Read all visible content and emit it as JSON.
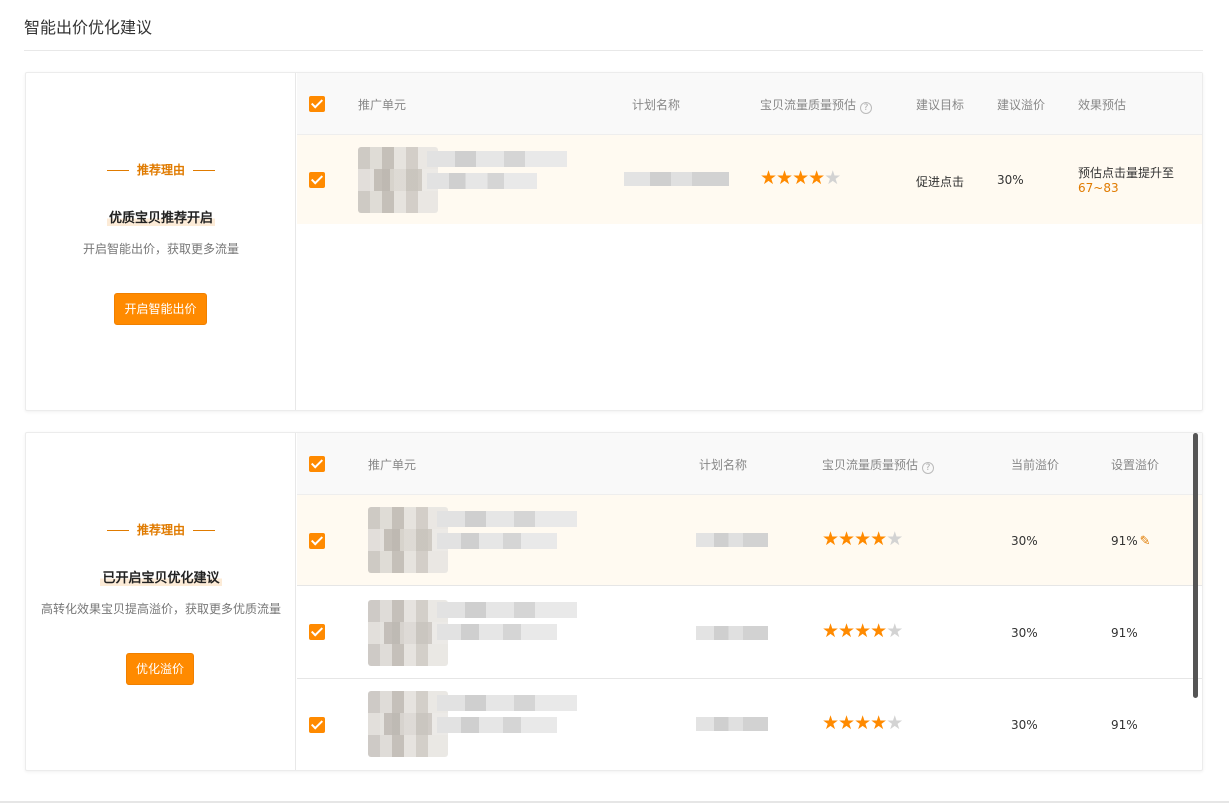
{
  "page_title": "智能出价优化建议",
  "colors": {
    "accent": "#ff8a00",
    "accent_text": "#e07b00",
    "highlight_row": "#fffaf1"
  },
  "section1": {
    "reason_tag": "推荐理由",
    "reason_title": "优质宝贝推荐开启",
    "reason_desc": "开启智能出价，获取更多流量",
    "action_button": "开启智能出价",
    "columns": [
      "推广单元",
      "计划名称",
      "宝贝流量质量预估",
      "建议目标",
      "建议溢价",
      "效果预估"
    ],
    "rows": [
      {
        "checked": true,
        "rating": 4,
        "target": "促进点击",
        "premium": "30%",
        "effect_label": "预估点击量提升至",
        "effect_value": "67~83"
      }
    ]
  },
  "section2": {
    "reason_tag": "推荐理由",
    "reason_title": "已开启宝贝优化建议",
    "reason_desc": "高转化效果宝贝提高溢价，获取更多优质流量",
    "action_button": "优化溢价",
    "columns": [
      "推广单元",
      "计划名称",
      "宝贝流量质量预估",
      "当前溢价",
      "设置溢价"
    ],
    "rows": [
      {
        "checked": true,
        "rating": 4,
        "current": "30%",
        "setting": "91%",
        "editable": true
      },
      {
        "checked": true,
        "rating": 4,
        "current": "30%",
        "setting": "91%",
        "editable": false
      },
      {
        "checked": true,
        "rating": 4,
        "current": "30%",
        "setting": "91%",
        "editable": false
      }
    ]
  },
  "icons": {
    "help": "question-circle-icon",
    "edit": "pencil-icon",
    "check": "checkbox-checked-icon",
    "star": "star-icon"
  }
}
